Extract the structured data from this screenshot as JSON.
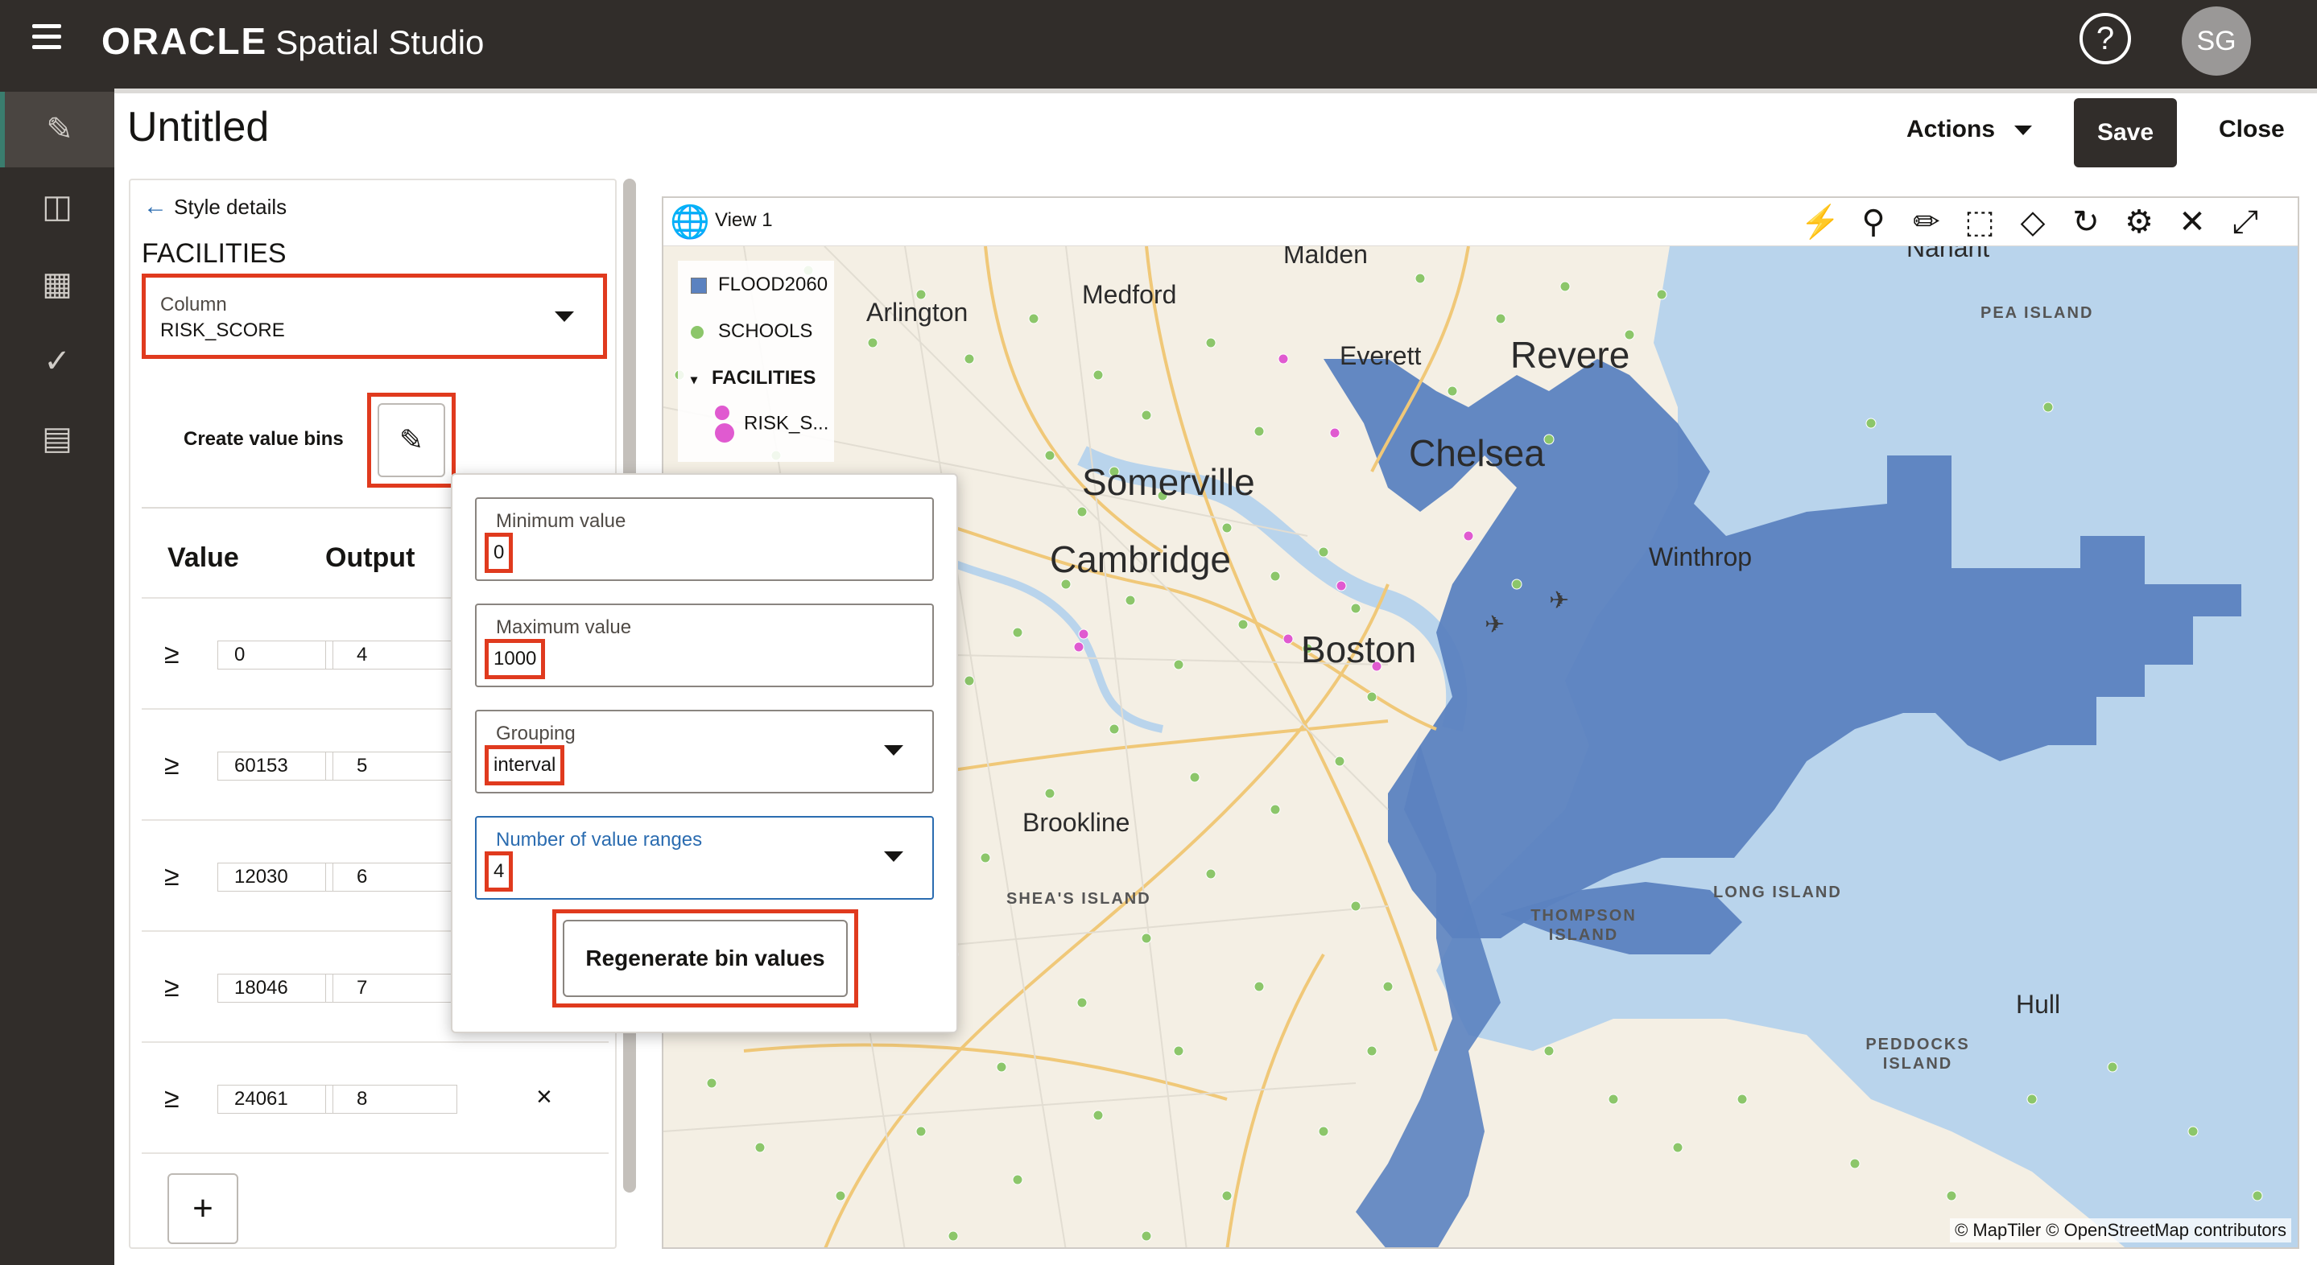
{
  "app": {
    "brand": "ORACLE",
    "product": "Spatial Studio",
    "avatar_initials": "SG"
  },
  "header": {
    "title": "Untitled",
    "actions_label": "Actions",
    "save_label": "Save",
    "close_label": "Close"
  },
  "style_panel": {
    "back_label": "Style details",
    "layer_name": "FACILITIES",
    "column_label": "Column",
    "column_value": "RISK_SCORE",
    "create_bins_label": "Create value bins",
    "col_value_header": "Value",
    "col_output_header": "Output",
    "bins": [
      {
        "op": "≥",
        "value": "0",
        "output": "4"
      },
      {
        "op": "≥",
        "value": "60153",
        "output": "5"
      },
      {
        "op": "≥",
        "value": "12030",
        "output": "6"
      },
      {
        "op": "≥",
        "value": "18046",
        "output": "7"
      },
      {
        "op": "≥",
        "value": "24061",
        "output": "8"
      }
    ],
    "remove_label": "×",
    "add_label": "+"
  },
  "popover": {
    "min_label": "Minimum value",
    "min_value": "0",
    "max_label": "Maximum value",
    "max_value": "1000",
    "grouping_label": "Grouping",
    "grouping_value": "interval",
    "ranges_label": "Number of value ranges",
    "ranges_value": "4",
    "regenerate_label": "Regenerate bin values"
  },
  "map": {
    "view_title": "View 1",
    "legend": {
      "flood": "FLOOD2060",
      "schools": "SCHOOLS",
      "facilities": "FACILITIES",
      "risk": "RISK_S..."
    },
    "attribution": "© MapTiler  © OpenStreetMap contributors",
    "labels": {
      "malden": "Malden",
      "medford": "Medford",
      "arlington": "Arlington",
      "everett": "Everett",
      "revere": "Revere",
      "chelsea": "Chelsea",
      "somerville": "Somerville",
      "cambridge": "Cambridge",
      "winthrop": "Winthrop",
      "boston": "Boston",
      "brookline": "Brookline",
      "nahant": "Nahant",
      "pea_island": "PEA ISLAND",
      "sheas_island": "SHEA'S ISLAND",
      "long_island": "LONG ISLAND",
      "thompson_island": "THOMPSON ISLAND",
      "hull": "Hull",
      "peddocks_island": "PEDDOCKS ISLAND"
    },
    "colors": {
      "flood": "#5b82c0",
      "schools": "#8cc66a",
      "facilities": "#e05ad0",
      "water": "#b9d4ec",
      "land": "#f4efe4"
    }
  }
}
